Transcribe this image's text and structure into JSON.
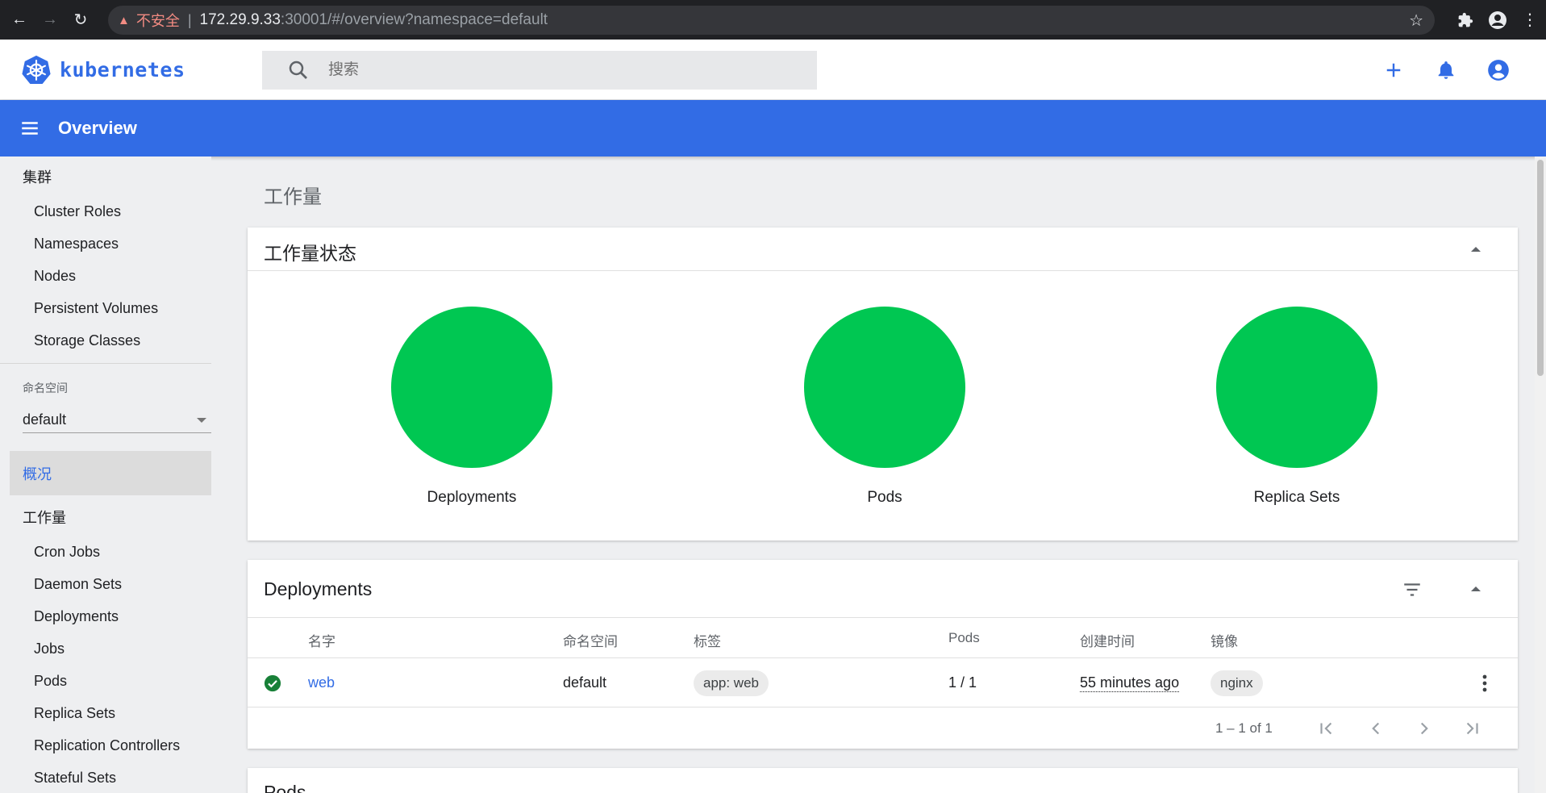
{
  "browser": {
    "insecure_label": "不安全",
    "url_host": "172.29.9.33",
    "url_rest": ":30001/#/overview?namespace=default"
  },
  "header": {
    "logo_text": "kubernetes",
    "search_placeholder": "搜索"
  },
  "toolbar": {
    "title": "Overview"
  },
  "sidebar": {
    "cluster_group": "集群",
    "cluster_items": [
      "Cluster Roles",
      "Namespaces",
      "Nodes",
      "Persistent Volumes",
      "Storage Classes"
    ],
    "namespace_label": "命名空间",
    "namespace_value": "default",
    "overview_label": "概况",
    "workloads_group": "工作量",
    "workload_items": [
      "Cron Jobs",
      "Daemon Sets",
      "Deployments",
      "Jobs",
      "Pods",
      "Replica Sets",
      "Replication Controllers",
      "Stateful Sets"
    ]
  },
  "main": {
    "heading": "工作量",
    "status_card": {
      "title": "工作量状态",
      "charts": [
        "Deployments",
        "Pods",
        "Replica Sets"
      ]
    },
    "deployments": {
      "title": "Deployments",
      "columns": {
        "name": "名字",
        "namespace": "命名空间",
        "labels": "标签",
        "pods": "Pods",
        "created": "创建时间",
        "images": "镜像"
      },
      "rows": [
        {
          "name": "web",
          "namespace": "default",
          "label": "app: web",
          "pods": "1 / 1",
          "created": "55 minutes ago",
          "image": "nginx"
        }
      ],
      "pager_range": "1 – 1 of 1"
    },
    "next_card_title": "Pods"
  },
  "colors": {
    "accent": "#326ce5",
    "ok": "#00c752",
    "ok_icon": "#188038"
  }
}
